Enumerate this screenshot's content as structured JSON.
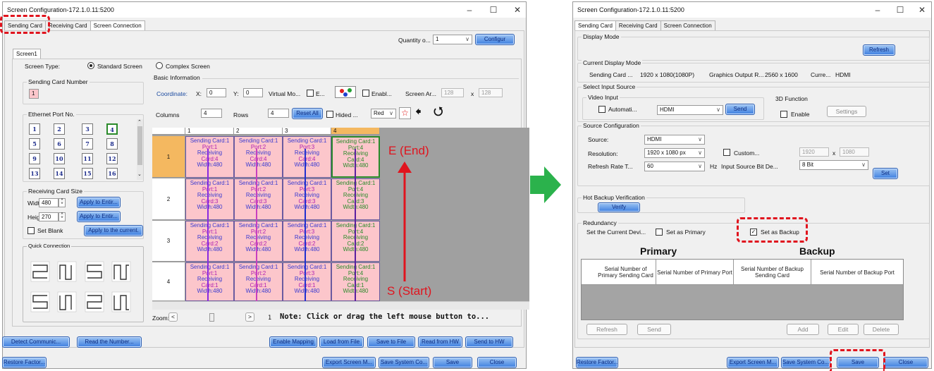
{
  "left": {
    "title": "Screen Configuration-172.1.0.11:5200",
    "tabs": [
      "Sending Card",
      "Receiving Card",
      "Screen Connection"
    ],
    "quantity_label": "Quantity o...",
    "quantity_value": "1",
    "configure_btn": "Configur",
    "screen_tab": "Screen1",
    "screen_type_label": "Screen Type:",
    "standard_screen": "Standard Screen",
    "complex_screen": "Complex Screen",
    "sending_card_number_label": "Sending Card Number",
    "sending_card_number_value": "1",
    "ethernet_port_label": "Ethernet Port No.",
    "ports": [
      "1",
      "2",
      "3",
      "4",
      "5",
      "6",
      "7",
      "8",
      "9",
      "10",
      "11",
      "12",
      "13",
      "14",
      "15",
      "16"
    ],
    "rc_size_label": "Receiving Card Size",
    "width_label": "Width:",
    "width_value": "480",
    "height_label": "Height:",
    "height_value": "270",
    "apply_entire_1": "Apply to Entir...",
    "apply_entire_2": "Apply to Entir...",
    "set_blank": "Set Blank",
    "apply_current": "Apply to the current.",
    "quick_connection": "Quick Connection",
    "basic_info": "Basic Information",
    "coordinate_label": "Coordinate:",
    "x_label": "X:",
    "x_value": "0",
    "y_label": "Y:",
    "y_value": "0",
    "virtual_mode": "Virtual Mo...",
    "e_label": "E...",
    "enable_label": "Enabl...",
    "screen_area": "Screen Ar...",
    "screen_w": "128",
    "times": "x",
    "screen_h": "128",
    "columns_label": "Columns",
    "columns_value": "4",
    "rows_label": "Rows",
    "rows_value": "4",
    "reset_all": "Reset All",
    "hided": "Hided ...",
    "color_sel": "Red",
    "col_headers": [
      "1",
      "2",
      "3",
      "4"
    ],
    "rows": [
      {
        "num": "1",
        "cells": [
          [
            "Sending Card:1",
            "Port:1",
            "Receiving",
            "Card:4",
            "Width:480"
          ],
          [
            "Sending Card:1",
            "Port:2",
            "Receiving",
            "Card:4",
            "Width:480"
          ],
          [
            "Sending Card:1",
            "Port:3",
            "Receiving",
            "Card:4",
            "Width:480"
          ],
          [
            "Sending Card:1",
            "Port:4",
            "Receiving",
            "Card:4",
            "Width:480"
          ]
        ]
      },
      {
        "num": "2",
        "cells": [
          [
            "Sending Card:1",
            "Port:1",
            "Receiving",
            "Card:3",
            "Width:480"
          ],
          [
            "Sending Card:1",
            "Port:2",
            "Receiving",
            "Card:3",
            "Width:480"
          ],
          [
            "Sending Card:1",
            "Port:3",
            "Receiving",
            "Card:3",
            "Width:480"
          ],
          [
            "Sending Card:1",
            "Port:4",
            "Receiving",
            "Card:3",
            "Width:480"
          ]
        ]
      },
      {
        "num": "3",
        "cells": [
          [
            "Sending Card:1",
            "Port:1",
            "Receiving",
            "Card:2",
            "Width:480"
          ],
          [
            "Sending Card:1",
            "Port:2",
            "Receiving",
            "Card:2",
            "Width:480"
          ],
          [
            "Sending Card:1",
            "Port:3",
            "Receiving",
            "Card:2",
            "Width:480"
          ],
          [
            "Sending Card:1",
            "Port:4",
            "Receiving",
            "Card:2",
            "Width:480"
          ]
        ]
      },
      {
        "num": "4",
        "cells": [
          [
            "Sending Card:1",
            "Port:1",
            "Receiving",
            "Card:1",
            "Width:480"
          ],
          [
            "Sending Card:1",
            "Port:2",
            "Receiving",
            "Card:1",
            "Width:480"
          ],
          [
            "Sending Card:1",
            "Port:3",
            "Receiving",
            "Card:1",
            "Width:480"
          ],
          [
            "Sending Card:1",
            "Port:4",
            "Receiving",
            "Card:1",
            "Width:480"
          ]
        ]
      }
    ],
    "end_label": "E (End)",
    "start_label": "S (Start)",
    "zoom_label": "Zoom:",
    "zoom_left": "<",
    "zoom_right": ">",
    "zoom_value": "1",
    "note": "Note: Click or drag the left mouse button to...",
    "bottom1": [
      "Detect Communic...",
      "Read the Number...",
      "Enable Mapping",
      "Load from File",
      "Save to File",
      "Read from HW",
      "Send to HW"
    ],
    "bottom2": [
      "Restore Factor...",
      "Export Screen M...",
      "Save System Co...",
      "Save",
      "Close"
    ]
  },
  "right": {
    "title": "Screen Configuration-172.1.0.11:5200",
    "tabs": [
      "Sending Card",
      "Receiving Card",
      "Screen Connection"
    ],
    "display_mode": "Display Mode",
    "refresh_btn": "Refresh",
    "current_display_mode": "Current Display Mode",
    "sending_card_label": "Sending Card ...",
    "sending_card_res": "1920 x 1080(1080P)",
    "graphics_output": "Graphics Output R...",
    "graphics_res": "2560 x 1600",
    "curr_label": "Curre...",
    "curr_value": "HDMI",
    "select_input": "Select Input Source",
    "video_input": "Video Input",
    "automatic": "Automati...",
    "input_value": "HDMI",
    "send_btn": "Send",
    "f3d": "3D Function",
    "enable": "Enable",
    "settings": "Settings",
    "source_config": "Source Configuration",
    "source_label": "Source:",
    "source_value": "HDMI",
    "resolution_label": "Resolution:",
    "resolution_value": "1920 x 1080 px",
    "custom": "Custom...",
    "custom_w": "1920",
    "times": "x",
    "custom_h": "1080",
    "refresh_rate_label": "Refresh Rate T...",
    "refresh_rate_value": "60",
    "hz": "Hz",
    "bit_depth_label": "Input Source Bit De...",
    "bit_depth_value": "8 Bit",
    "set_btn": "Set",
    "hot_backup": "Hot Backup Verification",
    "verify_btn": "Verify",
    "redundancy": "Redundancy",
    "set_current": "Set the Current Devi...",
    "set_primary": "Set as Primary",
    "set_backup": "Set as Backup",
    "primary": "Primary",
    "backup": "Backup",
    "table_headers": [
      "Serial Number of Primary Sending Card",
      "Serial Number of Primary Port",
      "Serial Number of Backup Sending Card",
      "Serial Number of Backup Port"
    ],
    "btns": [
      "Refresh",
      "Send",
      "Add",
      "Edit",
      "Delete"
    ],
    "bottom": [
      "Restore Factor...",
      "Export Screen M...",
      "Save System Co...",
      "Save",
      "Close"
    ]
  },
  "colors": {
    "accent_red": "#e0141e",
    "arrow_green": "#2bb24c",
    "cell_pink": "#fcc6cb"
  }
}
